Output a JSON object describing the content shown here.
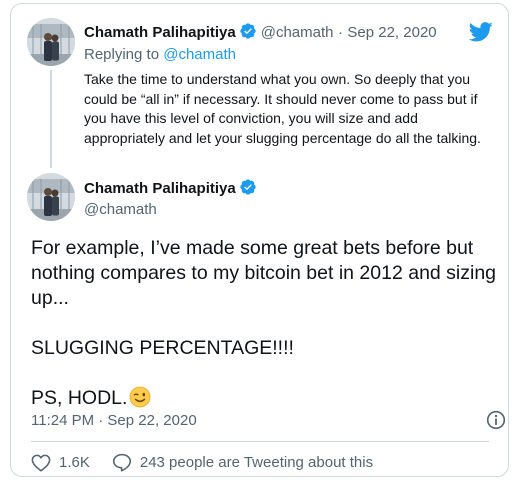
{
  "reply_tweet": {
    "author_name": "Chamath Palihapitiya",
    "handle": "@chamath",
    "separator": "·",
    "date": "Sep 22, 2020",
    "replying_to_prefix": "Replying to",
    "replying_to_handle": "@chamath",
    "text": "Take the time to understand what you own. So deeply that you could be “all in” if necessary. It should never come to pass but if you have this level of conviction, you will size and add appropriately and let your slugging percentage do all the talking."
  },
  "main_tweet": {
    "author_name": "Chamath Palihapitiya",
    "handle": "@chamath",
    "paragraphs": [
      "For example, I’ve made some great bets before but nothing compares to my bitcoin bet in 2012 and sizing up...",
      "SLUGGING PERCENTAGE!!!!",
      "PS, HODL."
    ],
    "emoji": "winking-face",
    "timestamp": "11:24 PM · Sep 22, 2020",
    "likes": "1.6K",
    "tweeting_about": "243 people are Tweeting about this"
  },
  "colors": {
    "twitter_blue": "#1d9bf0",
    "muted_text": "#536471",
    "border": "#cfd9de"
  }
}
